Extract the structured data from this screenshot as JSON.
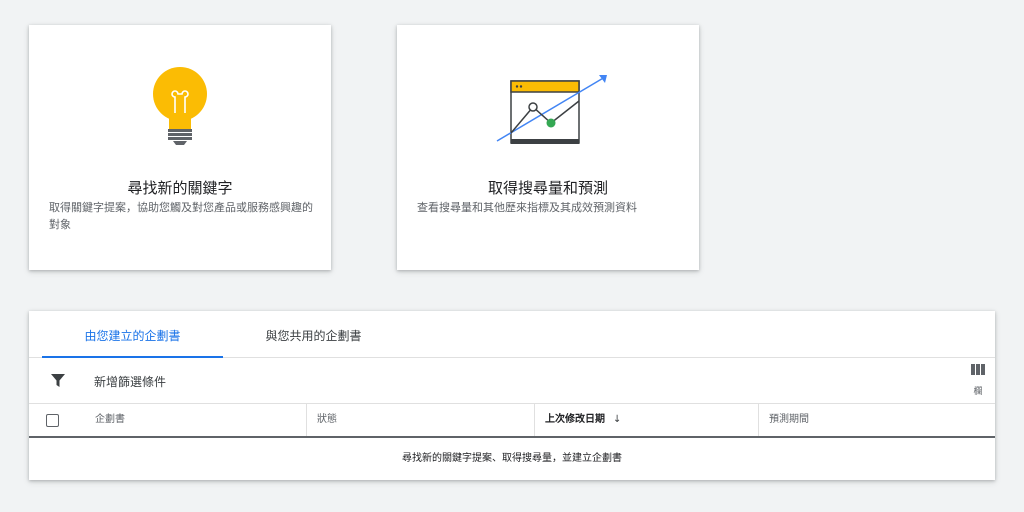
{
  "cards": {
    "keywords": {
      "title": "尋找新的關鍵字",
      "description": "取得關鍵字提案，協助您觸及對您產品或服務感興趣的對象",
      "icon": "lightbulb-icon"
    },
    "forecast": {
      "title": "取得搜尋量和預測",
      "description": "查看搜尋量和其他歷來指標及其成效預測資料",
      "icon": "trend-chart-icon"
    }
  },
  "plans": {
    "tabs": [
      {
        "label": "由您建立的企劃書",
        "active": true
      },
      {
        "label": "與您共用的企劃書",
        "active": false
      }
    ],
    "filter": {
      "label": "新增篩選條件",
      "icon": "filter-icon"
    },
    "columns_button": {
      "label": "欄",
      "icon": "columns-icon"
    },
    "table": {
      "headers": {
        "plan": "企劃書",
        "status": "狀態",
        "last_modified": "上次修改日期",
        "forecast_period": "預測期間"
      },
      "sort_icon": "↓",
      "empty_message": "尋找新的關鍵字提案、取得搜尋量，並建立企劃書"
    }
  },
  "colors": {
    "accent": "#1a73e8",
    "bulb": "#fbbc04",
    "point": "#34a853",
    "background": "#f1f3f4"
  }
}
